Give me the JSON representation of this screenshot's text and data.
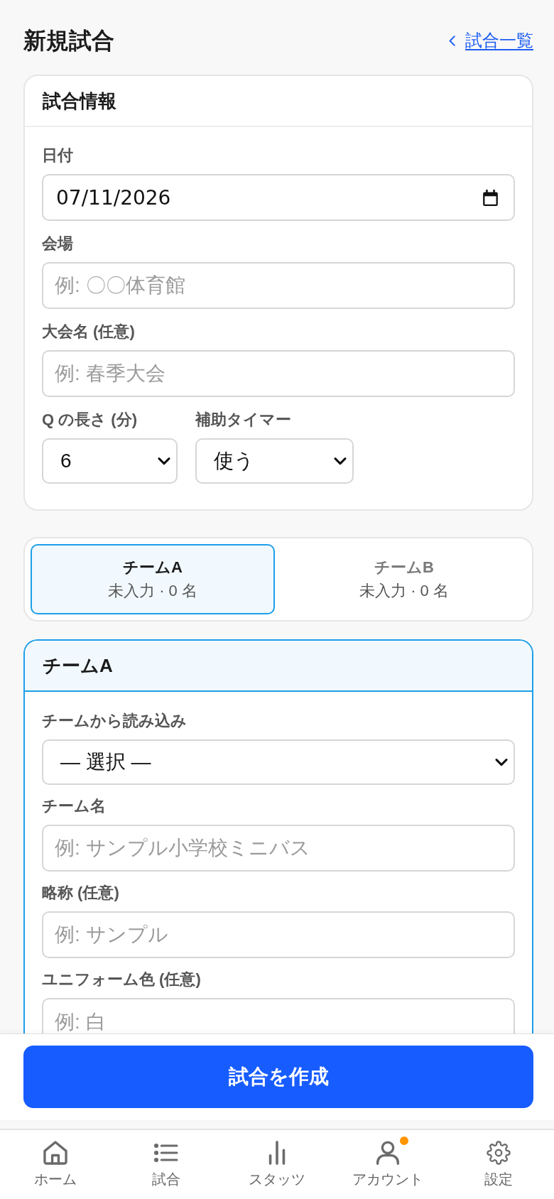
{
  "header": {
    "title": "新規試合",
    "back_link": "試合一覧"
  },
  "match_info": {
    "title": "試合情報",
    "fields": [
      {
        "kind": "date",
        "label": "日付",
        "value": "07/11/2026"
      },
      {
        "kind": "text",
        "label": "会場",
        "placeholder": "例: 〇〇体育館"
      },
      {
        "kind": "text",
        "label": "大会名 (任意)",
        "placeholder": "例: 春季大会"
      }
    ],
    "row": [
      {
        "kind": "select",
        "label": "Q の長さ (分)",
        "value": "6"
      },
      {
        "kind": "select",
        "label": "補助タイマー",
        "value": "使う"
      }
    ]
  },
  "team_tabs": [
    {
      "title": "チームA",
      "status": "未入力 · 0 名",
      "selected": true
    },
    {
      "title": "チームB",
      "status": "未入力 · 0 名",
      "selected": false
    }
  ],
  "team_form": {
    "title": "チームA",
    "fields": [
      {
        "kind": "select",
        "label": "チームから読み込み",
        "value": "— 選択 —"
      },
      {
        "kind": "text",
        "label": "チーム名",
        "placeholder": "例: サンプル小学校ミニバス"
      },
      {
        "kind": "text",
        "label": "略称 (任意)",
        "placeholder": "例: サンプル"
      },
      {
        "kind": "text",
        "label": "ユニフォーム色 (任意)",
        "placeholder": "例: 白"
      }
    ]
  },
  "submit_button": "試合を作成",
  "bottom_nav": [
    {
      "kind": "home",
      "label": "ホーム",
      "badge": false
    },
    {
      "kind": "list",
      "label": "試合",
      "badge": false
    },
    {
      "kind": "stats",
      "label": "スタッツ",
      "badge": false
    },
    {
      "kind": "account",
      "label": "アカウント",
      "badge": true
    },
    {
      "kind": "settings",
      "label": "設定",
      "badge": false
    }
  ]
}
